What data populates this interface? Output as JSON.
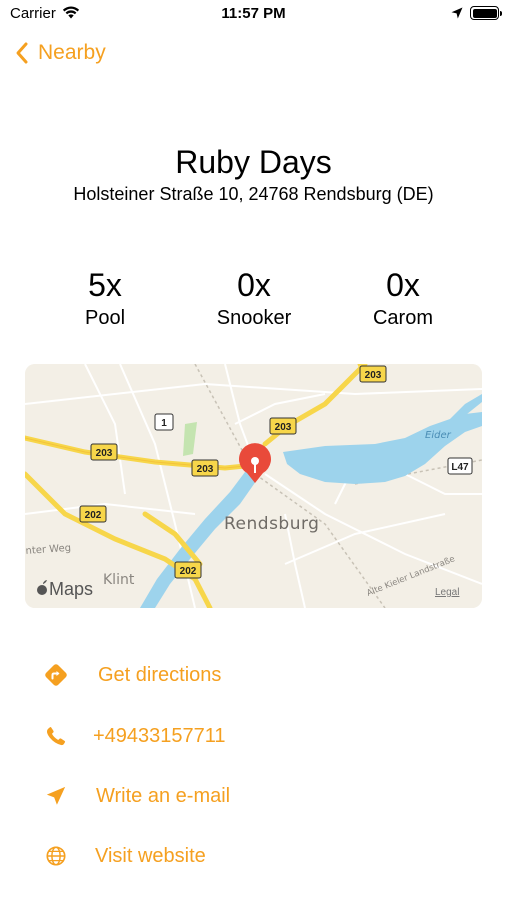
{
  "status_bar": {
    "carrier": "Carrier",
    "time": "11:57 PM"
  },
  "nav": {
    "back_label": "Nearby"
  },
  "venue": {
    "name": "Ruby Days",
    "address": "Holsteiner Straße 10, 24768 Rendsburg (DE)"
  },
  "stats": [
    {
      "count": "5x",
      "label": "Pool"
    },
    {
      "count": "0x",
      "label": "Snooker"
    },
    {
      "count": "0x",
      "label": "Carom"
    }
  ],
  "map": {
    "town": "Rendsburg",
    "klint": "Klint",
    "river": "Eider",
    "street_west": "inter Weg",
    "street_east": "Alte Kieler Landstraße",
    "logo": "Maps",
    "legal": "Legal",
    "road_badges": [
      "203",
      "1",
      "203",
      "203",
      "203",
      "L47",
      "202",
      "202"
    ]
  },
  "actions": [
    {
      "label": "Get directions",
      "icon": "directions-icon"
    },
    {
      "label": "+49433157711",
      "icon": "phone-icon"
    },
    {
      "label": "Write an e-mail",
      "icon": "send-icon"
    },
    {
      "label": "Visit website",
      "icon": "globe-icon"
    }
  ],
  "colors": {
    "accent": "#f5a020",
    "map_water": "#9dd3ec",
    "map_road": "#f7d64a",
    "pin": "#e94a3a"
  }
}
